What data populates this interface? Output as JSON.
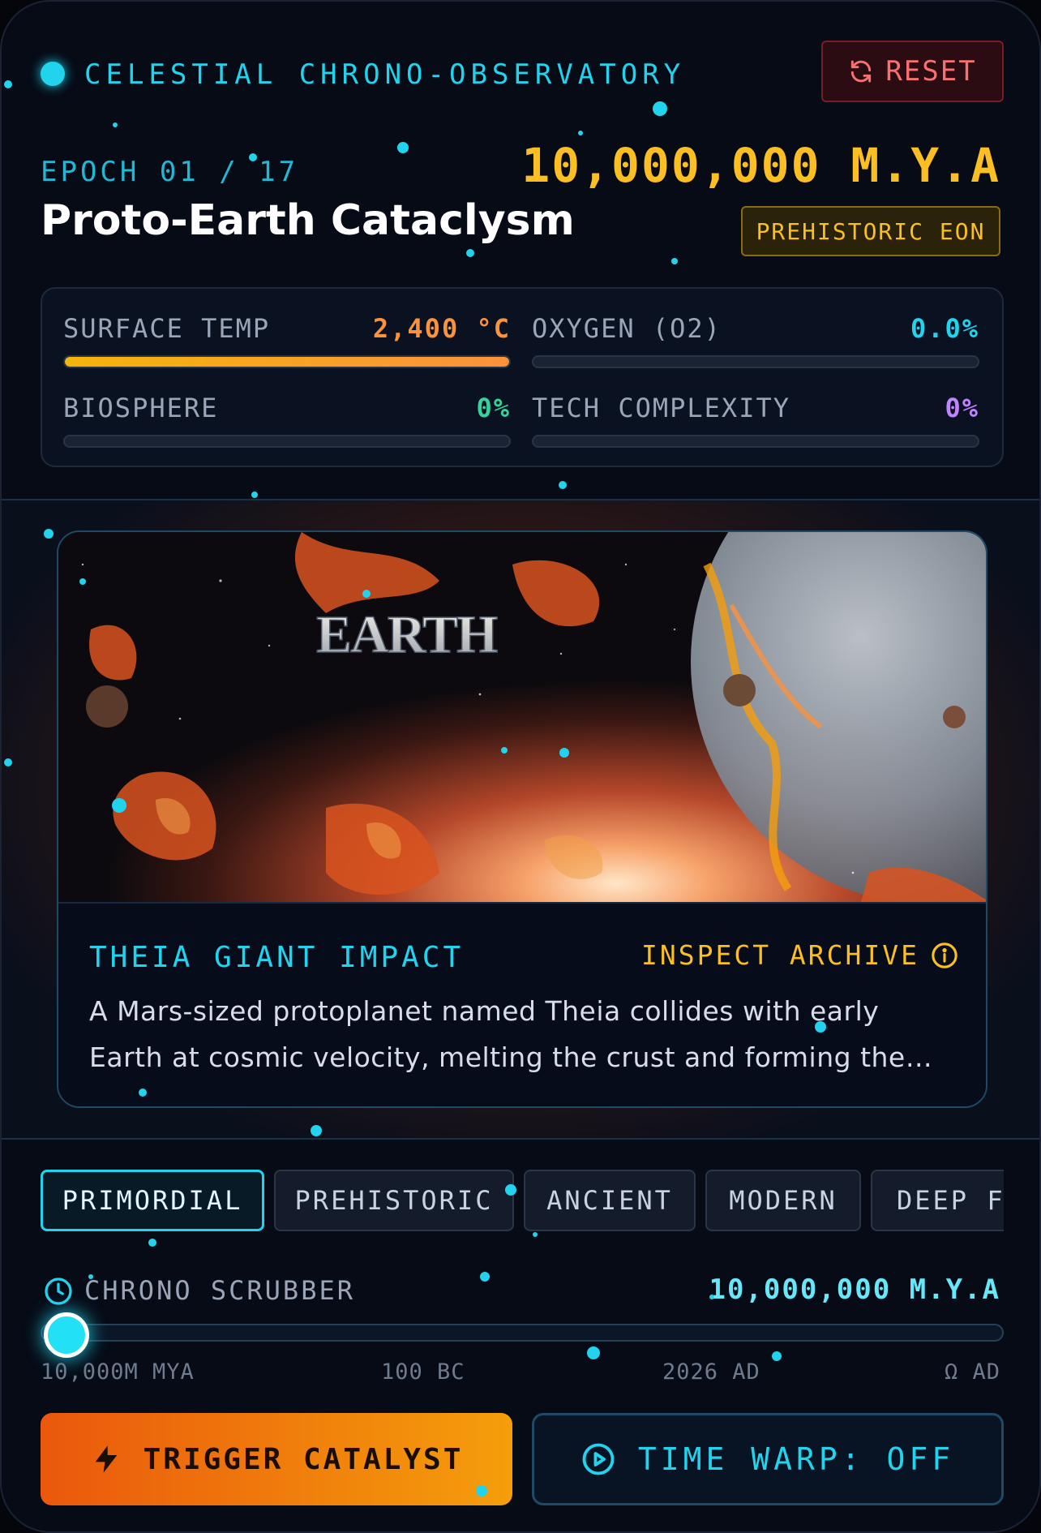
{
  "header": {
    "brand_title": "CELESTIAL CHRONO-OBSERVATORY",
    "reset_label": "RESET"
  },
  "epoch": {
    "label": "EPOCH 01 / 17",
    "title": "Proto-Earth Cataclysm",
    "date": "10,000,000 M.Y.A",
    "era_badge": "PREHISTORIC EON"
  },
  "stats": [
    {
      "label": "SURFACE TEMP",
      "value": "2,400 °C",
      "fill": 1.0,
      "color": "#fb923c"
    },
    {
      "label": "OXYGEN (O2)",
      "value": "0.0%",
      "fill": 0.0,
      "color": "#22d3ee"
    },
    {
      "label": "BIOSPHERE",
      "value": "0%",
      "fill": 0.0,
      "color": "#34d399"
    },
    {
      "label": "TECH COMPLEXITY",
      "value": "0%",
      "fill": 0.0,
      "color": "#c084fc"
    }
  ],
  "event": {
    "image_caption": "EARTH",
    "name": "THEIA GIANT IMPACT",
    "inspect_label": "INSPECT ARCHIVE",
    "description": "A Mars-sized protoplanet named Theia collides with early Earth at cosmic velocity, melting the crust and forming the…"
  },
  "era_tabs": [
    {
      "label": "PRIMORDIAL",
      "active": true
    },
    {
      "label": "PREHISTORIC",
      "active": false
    },
    {
      "label": "ANCIENT",
      "active": false
    },
    {
      "label": "MODERN",
      "active": false
    },
    {
      "label": "DEEP FUTURE",
      "active": false
    }
  ],
  "scrubber": {
    "label": "CHRONO SCRUBBER",
    "value": "10,000,000 M.Y.A",
    "position": 0.0,
    "ticks": [
      "10,000M MYA",
      "100 BC",
      "2026 AD",
      "Ω AD"
    ]
  },
  "actions": {
    "trigger_label": "TRIGGER CATALYST",
    "warp_label": "TIME WARP: OFF"
  },
  "colors": {
    "accent_cyan": "#22d3ee",
    "accent_amber": "#fbbf24",
    "danger_red": "#f87171",
    "background": "#060b16"
  }
}
